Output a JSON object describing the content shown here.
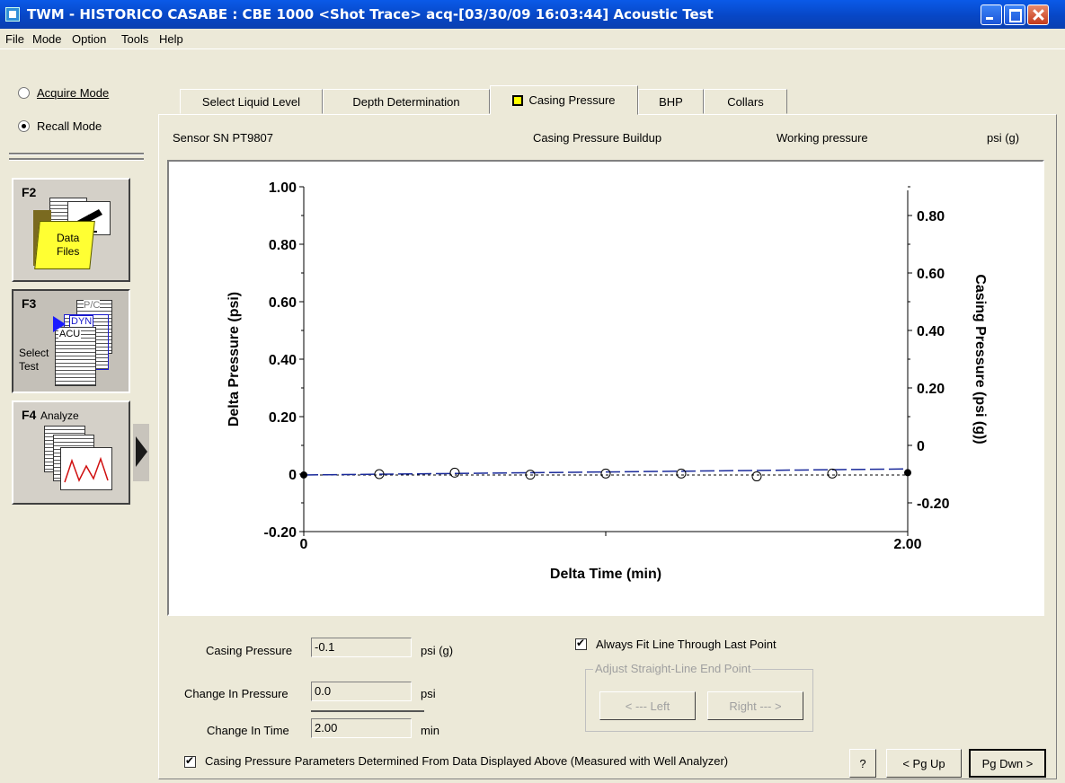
{
  "window": {
    "title": "TWM  -  HISTORICO CASABE : CBE 1000  <Shot Trace>  acq-[03/30/09 16:03:44]  Acoustic Test"
  },
  "menu": [
    "File",
    "Mode",
    "Option",
    "Tools",
    "Help"
  ],
  "left_panel": {
    "modes": [
      {
        "label": "Acquire Mode",
        "selected": false
      },
      {
        "label": "Recall Mode",
        "selected": true
      }
    ],
    "f2": {
      "key": "F2",
      "label_line1": "Data",
      "label_line2": "Files"
    },
    "f3": {
      "key": "F3",
      "label_line1": "Select",
      "label_line2": "Test",
      "doc1": "P/C",
      "doc2": "DYN",
      "doc3": "ACU"
    },
    "f4": {
      "key": "F4",
      "label": "Analyze"
    }
  },
  "tabs": [
    {
      "label": "Select Liquid Level",
      "active": false
    },
    {
      "label": "Depth Determination",
      "active": false
    },
    {
      "label": "Casing Pressure",
      "active": true
    },
    {
      "label": "BHP",
      "active": false
    },
    {
      "label": "Collars",
      "active": false
    }
  ],
  "header": {
    "sensor": "Sensor SN  PT9807",
    "title": "Casing Pressure Buildup",
    "working": "Working pressure",
    "unit": "psi (g)"
  },
  "chart_data": {
    "type": "scatter",
    "xlabel": "Delta Time (min)",
    "ylabel": "Delta Pressure (psi)",
    "ylabel_right": "Casing Pressure (psi (g))",
    "xlim": [
      0,
      2.0
    ],
    "ylim": [
      -0.2,
      1.0
    ],
    "ylim_right": [
      -0.3,
      0.9
    ],
    "x_ticks": [
      "0",
      "2.00"
    ],
    "y_ticks": [
      "-0.20",
      "0",
      "0.20",
      "0.40",
      "0.60",
      "0.80",
      "1.00"
    ],
    "y_ticks_right": [
      "-0.20",
      "0",
      "0.20",
      "0.40",
      "0.60",
      "0.80"
    ],
    "grid": false,
    "series": [
      {
        "x": [
          0,
          0.25,
          0.5,
          0.75,
          1.0,
          1.25,
          1.5,
          1.75,
          2.0
        ],
        "values": [
          -0.003,
          0.0,
          0.005,
          -0.002,
          0.002,
          0.002,
          -0.008,
          0.002,
          0.005
        ]
      }
    ],
    "fit_line": {
      "x": [
        0,
        2.0
      ],
      "y": [
        -0.003,
        0.018
      ]
    },
    "baseline": {
      "x": [
        0,
        2.0
      ],
      "y": [
        -0.003,
        -0.003
      ]
    }
  },
  "form": {
    "casing_pressure_label": "Casing Pressure",
    "casing_pressure_value": "-0.1",
    "casing_pressure_unit": "psi (g)",
    "change_pressure_label": "Change In Pressure",
    "change_pressure_value": "0.0",
    "change_pressure_unit": "psi",
    "change_time_label": "Change In Time",
    "change_time_value": "2.00",
    "change_time_unit": "min",
    "fit_last_point": "Always Fit Line Through Last Point",
    "adjust_group": "Adjust Straight-Line End Point",
    "left_btn": "< --- Left",
    "right_btn": "Right --- >",
    "parameters_check": "Casing Pressure Parameters Determined From Data Displayed Above (Measured with Well Analyzer)",
    "help_btn": "?",
    "pgup_btn": "< Pg Up",
    "pgdn_btn": "Pg Dwn >"
  }
}
